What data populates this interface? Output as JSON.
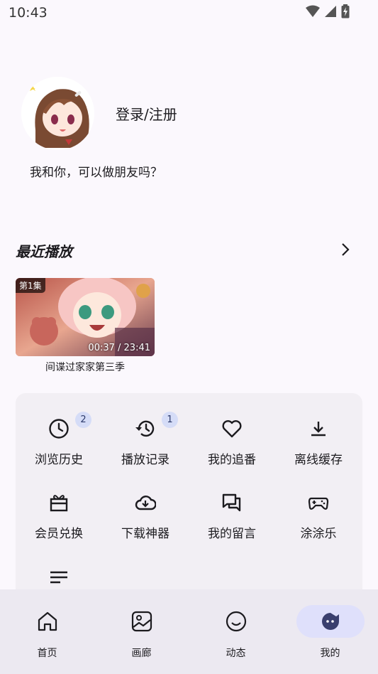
{
  "status_bar": {
    "time": "10:43"
  },
  "profile": {
    "login_label": "登录/注册",
    "signature": "我和你，可以做朋友吗？"
  },
  "recent": {
    "title": "最近播放",
    "items": [
      {
        "episode": "第1集",
        "duration": "00:37 / 23:41",
        "title": "间谍过家家第三季"
      }
    ]
  },
  "menu": {
    "items": [
      {
        "label": "浏览历史",
        "icon": "clock-icon",
        "badge": "2"
      },
      {
        "label": "播放记录",
        "icon": "history-icon",
        "badge": "1"
      },
      {
        "label": "我的追番",
        "icon": "heart-icon"
      },
      {
        "label": "离线缓存",
        "icon": "download-icon"
      },
      {
        "label": "会员兑换",
        "icon": "gift-icon"
      },
      {
        "label": "下载神器",
        "icon": "cloud-download-icon"
      },
      {
        "label": "我的留言",
        "icon": "chat-icon"
      },
      {
        "label": "涂涂乐",
        "icon": "gamepad-icon"
      },
      {
        "label": "",
        "icon": "list-icon"
      }
    ]
  },
  "bottom_nav": {
    "items": [
      {
        "label": "首页",
        "icon": "home-icon"
      },
      {
        "label": "画廊",
        "icon": "gallery-icon"
      },
      {
        "label": "动态",
        "icon": "smile-icon"
      },
      {
        "label": "我的",
        "icon": "profile-icon",
        "active": true
      }
    ]
  },
  "colors": {
    "accent": "#dfe0fb",
    "card": "#f2eff4",
    "badge": "#d5dcf7",
    "nav_bg": "#ece9f1"
  }
}
